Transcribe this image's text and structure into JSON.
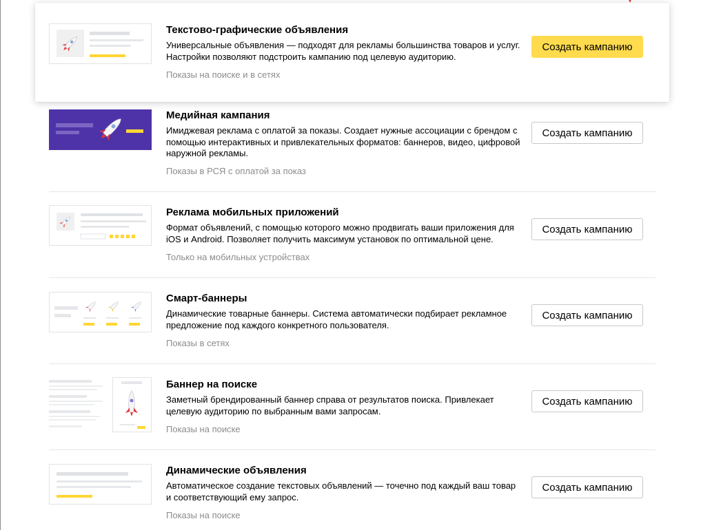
{
  "campaigns": [
    {
      "title": "Текстово-графические объявления",
      "description": "Универсальные объявления — подходят для рекламы большинства товаров и услуг. Настройки позволяют подстроить кампанию под целевую аудиторию.",
      "note": "Показы на поиске и в сетях",
      "button_label": "Создать кампанию",
      "icon": "rocket-text-ad-icon"
    },
    {
      "title": "Медийная кампания",
      "description": "Имиджевая реклама с оплатой за показы. Создает нужные ассоциации с брендом с помощью интерактивных и привлекательных форматов: баннеров, видео, цифровой наружной рекламы.",
      "note": "Показы в РСЯ с оплатой за показ",
      "button_label": "Создать кампанию",
      "icon": "rocket-media-banner-icon"
    },
    {
      "title": "Реклама мобильных приложений",
      "description": "Формат объявлений, с помощью которого можно продвигать ваши приложения для iOS и Android. Позволяет получить максимум установок по оптимальной цене.",
      "note": "Только на мобильных устройствах",
      "button_label": "Создать кампанию",
      "icon": "rocket-app-ad-icon"
    },
    {
      "title": "Смарт-баннеры",
      "description": "Динамические товарные баннеры. Система автоматически подбирает рекламное предложение под каждого конкретного пользователя.",
      "note": "Показы в сетях",
      "button_label": "Создать кампанию",
      "icon": "smart-banners-icon"
    },
    {
      "title": "Баннер на поиске",
      "description": "Заметный брендированный баннер справа от результатов поиска. Привлекает целевую аудиторию по выбранным вами запросам.",
      "note": "Показы на поиске",
      "button_label": "Создать кампанию",
      "icon": "search-banner-icon"
    },
    {
      "title": "Динамические объявления",
      "description": "Автоматическое создание текстовых объявлений — точечно под каждый ваш товар и соответствующий ему запрос.",
      "note": "Показы на поиске",
      "button_label": "Создать кампанию",
      "icon": "dynamic-ads-icon"
    }
  ],
  "colors": {
    "primary_button": "#ffdb4d",
    "media_banner_bg": "#4e33a8",
    "accent_yellow": "#ffd633",
    "note_text": "#8c8c8c"
  }
}
